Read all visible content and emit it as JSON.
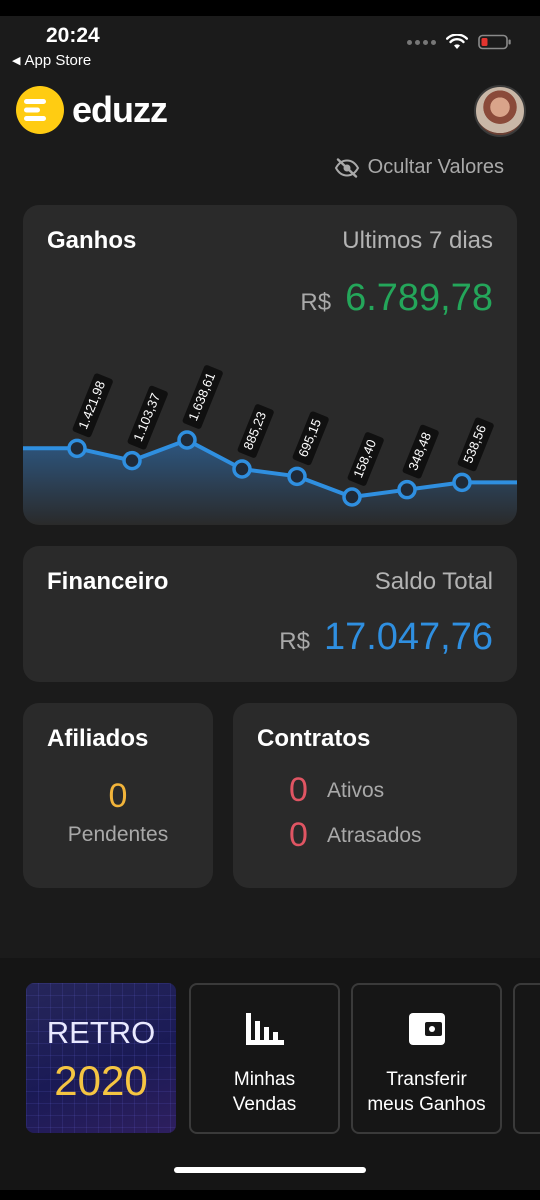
{
  "status_bar": {
    "time": "20:24",
    "back_label": "App Store"
  },
  "header": {
    "logo_text": "eduzz",
    "hide_values_label": "Ocultar Valores"
  },
  "ganhos": {
    "title": "Ganhos",
    "period": "Ultimos 7 dias",
    "currency": "R$",
    "total": "6.789,78"
  },
  "financeiro": {
    "title": "Financeiro",
    "subtitle": "Saldo Total",
    "currency": "R$",
    "total": "17.047,76"
  },
  "afiliados": {
    "title": "Afiliados",
    "count": "0",
    "label": "Pendentes"
  },
  "contratos": {
    "title": "Contratos",
    "rows": [
      {
        "count": "0",
        "label": "Ativos"
      },
      {
        "count": "0",
        "label": "Atrasados"
      }
    ]
  },
  "shortcuts": {
    "retro_top": "RETRO",
    "retro_year": "2020",
    "tiles": [
      {
        "label": "Minhas\nVendas",
        "icon": "bar-chart-icon"
      },
      {
        "label": "Transferir\nmeus Ganhos",
        "icon": "wallet-icon"
      }
    ]
  },
  "colors": {
    "background": "#1b1b1b",
    "card": "#2a2a2a",
    "ganhos_value": "#24a65a",
    "financeiro_value": "#2f8fe0",
    "afiliados_value": "#f2b43a",
    "contratos_value": "#e05563",
    "chart_line": "#2f8fe0"
  },
  "chart_data": {
    "type": "line",
    "values": [
      1421.98,
      1103.37,
      1638.61,
      885.23,
      695.15,
      158.4,
      348.48,
      538.56
    ],
    "labels": [
      "1.421,98",
      "1.103,37",
      "1.638,61",
      "885,23",
      "695,15",
      "158,40",
      "348,48",
      "538,56"
    ]
  }
}
